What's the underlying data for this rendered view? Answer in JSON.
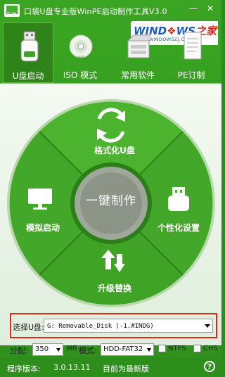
{
  "window": {
    "app_icon_text": "GBPE",
    "title": "口袋U盘专业版WinPE启动制作工具V3.0",
    "minimize": "—",
    "close": "✕"
  },
  "logo": {
    "brand_a": "WIND",
    "brand_b": "WS",
    "brand_c": "之家",
    "url": "WWW.WINDOWSZJ.COM"
  },
  "tabs": [
    {
      "label": "U盘启动",
      "icon": "usb-drive-icon",
      "active": true
    },
    {
      "label": "ISO 模式",
      "icon": "disc-iso-icon",
      "active": false
    },
    {
      "label": "常用软件",
      "icon": "software-box-icon",
      "active": false
    },
    {
      "label": "PE订制",
      "icon": "document-icon",
      "active": false
    }
  ],
  "wheel": {
    "center": "一键制作",
    "top": "格式化U盘",
    "left": "模拟启动",
    "right": "个性化设置",
    "bottom": "升级替换"
  },
  "select_usb": {
    "label": "选择U盘:",
    "value": "G: Removable_Disk (-1.#INDG)"
  },
  "options": {
    "partition_label": "分配:",
    "partition_value": "350",
    "unit": "MB",
    "mode_label": "模式:",
    "mode_value": "HDD-FAT32",
    "ntfs_label": "NTFS",
    "chs_label": "CHS"
  },
  "status": {
    "version_label": "程序版本:",
    "version": "3.0.13.11",
    "latest": "目前为最新版",
    "help": "?"
  },
  "colors": {
    "accent_green": "#2f8f1c",
    "wheel_green": "#45ab2a",
    "highlight_red": "#e0271c"
  }
}
